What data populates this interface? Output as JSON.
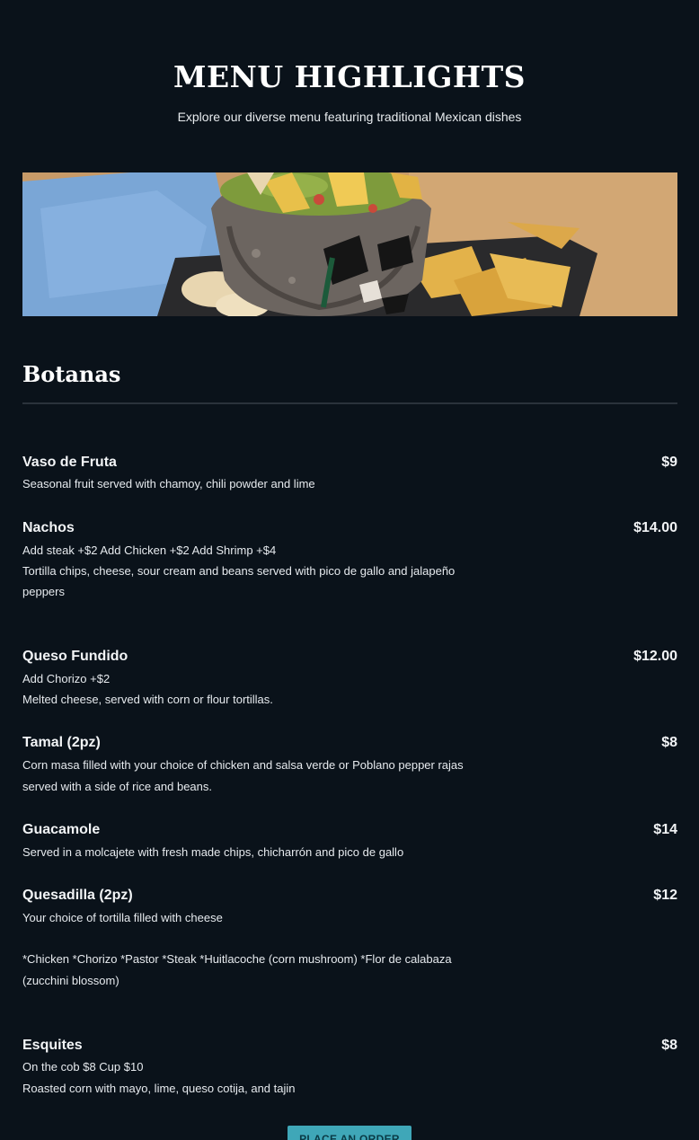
{
  "hero": {
    "title": "MENU HIGHLIGHTS",
    "subtitle": "Explore our diverse menu featuring traditional Mexican dishes"
  },
  "banner": {
    "image": "guacamole-molcajete-photo"
  },
  "section": {
    "title": "Botanas"
  },
  "items": [
    {
      "name": "Vaso de Fruta",
      "price": "$9",
      "lines": [
        "Seasonal fruit served with chamoy, chili powder and lime"
      ]
    },
    {
      "name": "Nachos",
      "price": "$14.00",
      "lines": [
        "Add steak +$2 Add Chicken +$2 Add Shrimp +$4",
        "Tortilla chips, cheese, sour cream and beans served with pico de gallo and jalapeño",
        "peppers"
      ]
    },
    {
      "name": "Queso Fundido",
      "price": "$12.00",
      "lines": [
        "Add Chorizo +$2",
        "Melted cheese, served with corn or flour tortillas."
      ]
    },
    {
      "name": "Tamal (2pz)",
      "price": "$8",
      "lines": [
        "Corn masa filled with your choice of chicken and salsa verde or Poblano pepper rajas",
        "served with a side of rice and beans."
      ]
    },
    {
      "name": "Guacamole",
      "price": "$14",
      "lines": [
        "Served in a molcajete with fresh made chips,  chicharrón and pico de gallo"
      ]
    },
    {
      "name": "Quesadilla (2pz)",
      "price": "$12",
      "lines": [
        "Your choice of tortilla filled with cheese",
        "*Chicken *Chorizo *Pastor *Steak *Huitlacoche (corn mushroom) *Flor de calabaza",
        "(zucchini blossom)"
      ]
    },
    {
      "name": "Esquites",
      "price": "$8",
      "lines": [
        "On the cob $8 Cup $10",
        "Roasted corn with mayo, lime, queso cotija, and tajin"
      ]
    }
  ],
  "cta": {
    "label": "PLACE AN ORDER"
  },
  "colors": {
    "background": "#0a121a",
    "accent": "#3fa7b8"
  }
}
